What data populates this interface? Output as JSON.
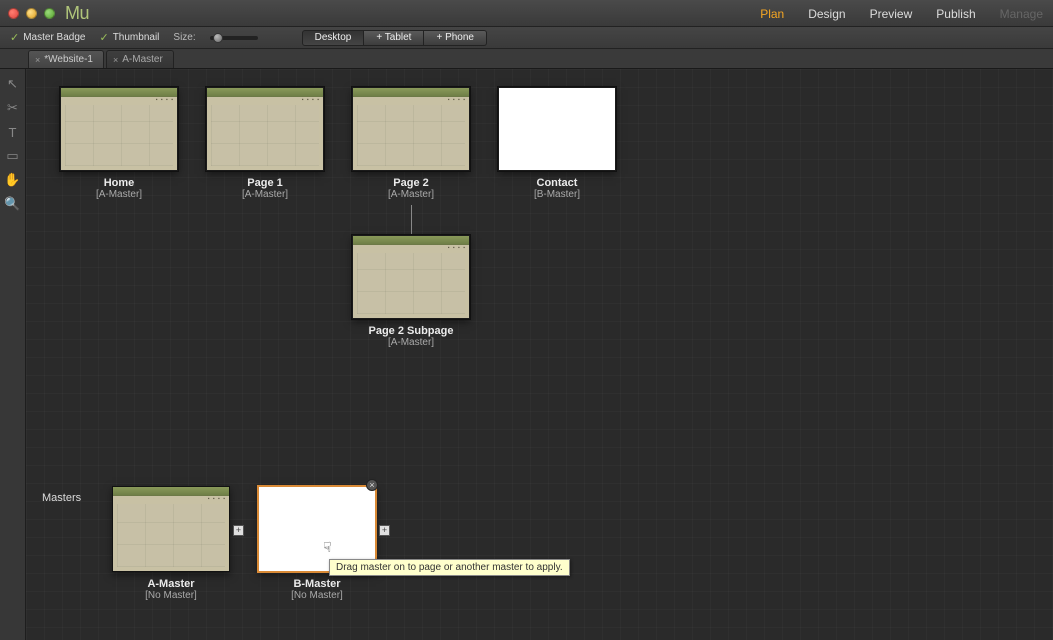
{
  "app": {
    "name": "Mu"
  },
  "topnav": {
    "plan": "Plan",
    "design": "Design",
    "preview": "Preview",
    "publish": "Publish",
    "manage": "Manage",
    "active": "plan"
  },
  "options": {
    "master_badge": "Master Badge",
    "thumbnail": "Thumbnail",
    "size_label": "Size:",
    "devices": {
      "desktop": "Desktop",
      "tablet": "+ Tablet",
      "phone": "+ Phone"
    }
  },
  "tabs": [
    {
      "label": "*Website-1",
      "closable": true,
      "active": true
    },
    {
      "label": "A-Master",
      "closable": true,
      "active": false
    }
  ],
  "pages": {
    "home": {
      "title": "Home",
      "master": "[A-Master]"
    },
    "page1": {
      "title": "Page 1",
      "master": "[A-Master]"
    },
    "page2": {
      "title": "Page 2",
      "master": "[A-Master]"
    },
    "contact": {
      "title": "Contact",
      "master": "[B-Master]"
    },
    "page2sub": {
      "title": "Page 2 Subpage",
      "master": "[A-Master]"
    }
  },
  "masters_section": {
    "heading": "Masters",
    "a": {
      "title": "A-Master",
      "master": "[No Master]"
    },
    "b": {
      "title": "B-Master",
      "master": "[No Master]"
    }
  },
  "tooltip": "Drag master on to page or another master to apply.",
  "icons": {
    "check": "✓",
    "close_x": "×",
    "plus": "+",
    "tool_pointer": "↖",
    "tool_crop": "✂",
    "tool_text": "T",
    "tool_rect": "▭",
    "tool_hand": "✋",
    "tool_zoom": "🔍",
    "drag_cursor": "☟"
  }
}
